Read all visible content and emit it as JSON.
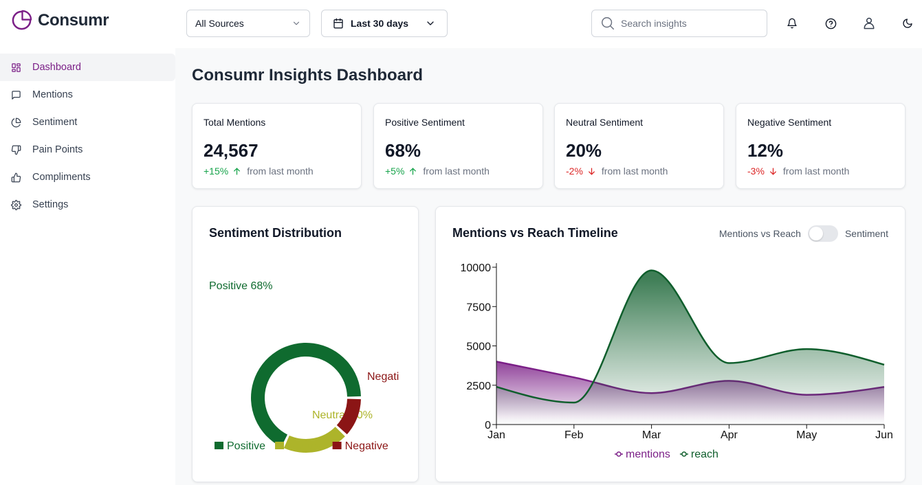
{
  "app": {
    "name": "Consumr"
  },
  "header": {
    "source_filter": "All Sources",
    "date_filter": "Last 30 days",
    "search_placeholder": "Search insights"
  },
  "sidebar": {
    "items": [
      {
        "label": "Dashboard",
        "icon": "dashboard-icon",
        "active": true
      },
      {
        "label": "Mentions",
        "icon": "message-icon"
      },
      {
        "label": "Sentiment",
        "icon": "pie-icon"
      },
      {
        "label": "Pain Points",
        "icon": "thumbs-down-icon"
      },
      {
        "label": "Compliments",
        "icon": "thumbs-up-icon"
      },
      {
        "label": "Settings",
        "icon": "gear-icon"
      }
    ]
  },
  "page": {
    "title": "Consumr Insights Dashboard"
  },
  "stats": [
    {
      "title": "Total Mentions",
      "value": "24,567",
      "change": "+15%",
      "direction": "up",
      "note": "from last month"
    },
    {
      "title": "Positive Sentiment",
      "value": "68%",
      "change": "+5%",
      "direction": "up",
      "note": "from last month"
    },
    {
      "title": "Neutral Sentiment",
      "value": "20%",
      "change": "-2%",
      "direction": "down",
      "note": "from last month"
    },
    {
      "title": "Negative Sentiment",
      "value": "12%",
      "change": "-3%",
      "direction": "down",
      "note": "from last month"
    }
  ],
  "sentiment_panel": {
    "title": "Sentiment Distribution"
  },
  "timeline_panel": {
    "title": "Mentions vs Reach Timeline",
    "toggle_left": "Mentions vs Reach",
    "toggle_right": "Sentiment"
  },
  "colors": {
    "brand": "#7b1f87",
    "positive": "#0f6b2f",
    "neutral": "#adb42a",
    "negative": "#8b1515",
    "mentions": "#7b1f87",
    "reach": "#0f5e2c"
  },
  "chart_data": [
    {
      "type": "pie",
      "donut": true,
      "slices": [
        {
          "name": "Positive",
          "value": 68,
          "label": "Positive 68%",
          "color": "#0f6b2f"
        },
        {
          "name": "Neutral",
          "value": 20,
          "label": "Neutral 20%",
          "color": "#adb42a"
        },
        {
          "name": "Negative",
          "value": 12,
          "label": "Negati",
          "color": "#8b1515"
        }
      ],
      "legend": [
        "Positive",
        "Neutral",
        "Negative"
      ],
      "legend_position": "bottom"
    },
    {
      "type": "area",
      "categories": [
        "Jan",
        "Feb",
        "Mar",
        "Apr",
        "May",
        "Jun"
      ],
      "series": [
        {
          "name": "mentions",
          "values": [
            4000,
            3000,
            2000,
            2780,
            1890,
            2390
          ],
          "color": "#7b1f87"
        },
        {
          "name": "reach",
          "values": [
            2400,
            1398,
            9800,
            3908,
            4800,
            3800
          ],
          "color": "#0f5e2c"
        }
      ],
      "ylim": [
        0,
        10000
      ],
      "yticks": [
        0,
        2500,
        5000,
        7500,
        10000
      ],
      "grid": false,
      "legend_position": "bottom"
    }
  ]
}
